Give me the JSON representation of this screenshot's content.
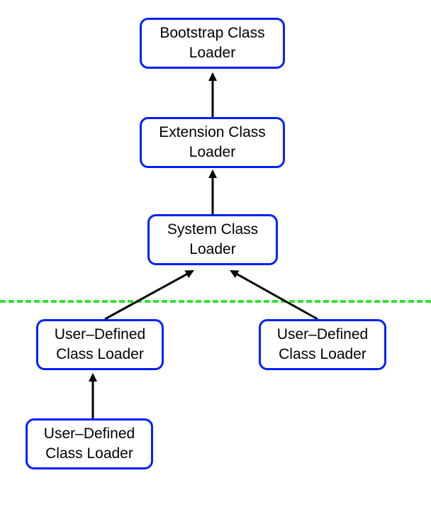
{
  "nodes": {
    "bootstrap": {
      "line1": "Bootstrap Class",
      "line2": "Loader"
    },
    "extension": {
      "line1": "Extension Class",
      "line2": "Loader"
    },
    "system": {
      "line1": "System Class",
      "line2": "Loader"
    },
    "user1": {
      "line1": "User–Defined",
      "line2": "Class Loader"
    },
    "user2": {
      "line1": "User–Defined",
      "line2": "Class Loader"
    },
    "user3": {
      "line1": "User–Defined",
      "line2": "Class Loader"
    }
  },
  "edges": [
    {
      "from": "extension",
      "to": "bootstrap"
    },
    {
      "from": "system",
      "to": "extension"
    },
    {
      "from": "user1",
      "to": "system"
    },
    {
      "from": "user2",
      "to": "system"
    },
    {
      "from": "user3",
      "to": "user1"
    }
  ],
  "colors": {
    "box_border": "#0020ff",
    "divider": "#33e333",
    "arrow": "#000000"
  }
}
